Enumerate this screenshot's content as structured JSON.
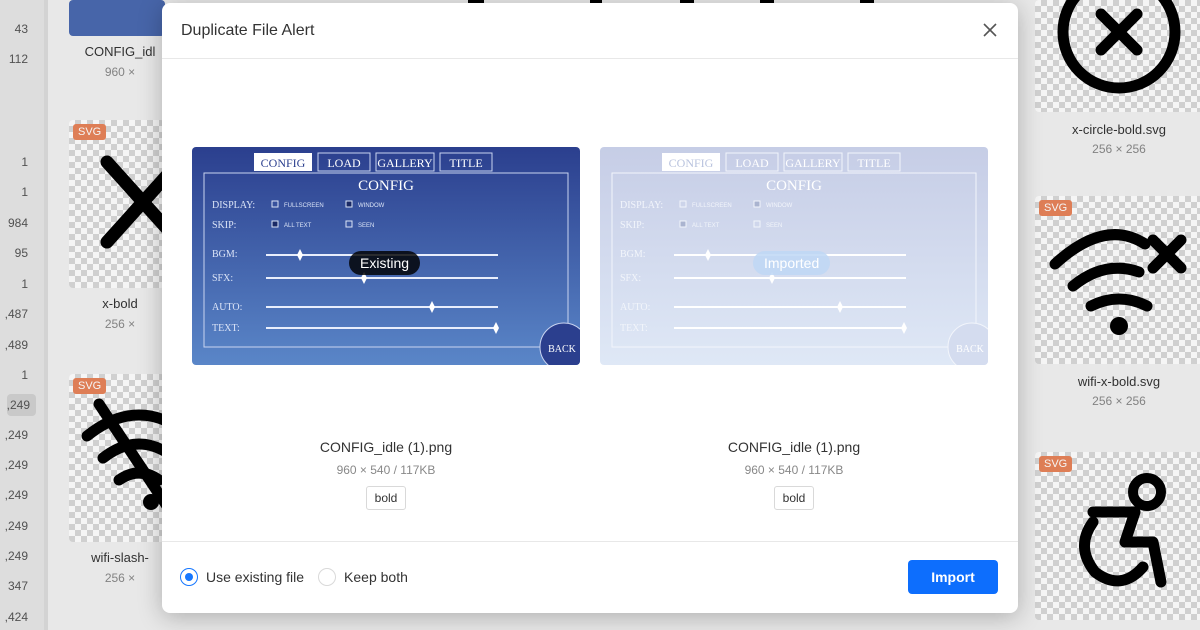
{
  "background": {
    "counts": [
      "43",
      "112",
      "1",
      "1",
      "984",
      "95",
      "1",
      ",487",
      ",489",
      "1",
      ",249",
      ",249",
      ",249",
      ",249",
      ",249",
      ",249",
      "347",
      ",424"
    ],
    "tiles": [
      {
        "name": "CONFIG_idl",
        "dim": "960 ×",
        "svg": false
      },
      {
        "name": "x-bold",
        "dim": "256 ×",
        "svg": true,
        "badge": "SVG"
      },
      {
        "name": "wifi-slash-",
        "dim": "256 ×",
        "svg": true,
        "badge": "SVG"
      },
      {
        "name": "x-circle-bold.svg",
        "dim": "256 × 256",
        "svg": false
      },
      {
        "name": "wifi-x-bold.svg",
        "dim": "256 × 256",
        "svg": true,
        "badge": "SVG"
      },
      {
        "name": "",
        "dim": "",
        "svg": true,
        "badge": "SVG"
      }
    ]
  },
  "modal": {
    "title": "Duplicate File Alert",
    "existing": {
      "chip": "Existing",
      "filename": "CONFIG_idle (1).png",
      "meta": "960 × 540 / 117KB",
      "tag": "bold"
    },
    "imported": {
      "chip": "Imported",
      "filename": "CONFIG_idle (1).png",
      "meta": "960 × 540 / 117KB",
      "tag": "bold"
    },
    "preview_text": {
      "tabs": [
        "CONFIG",
        "LOAD",
        "GALLERY",
        "TITLE"
      ],
      "heading": "CONFIG",
      "rows": [
        "DISPLAY:",
        "SKIP:",
        "BGM:",
        "SFX:",
        "AUTO:",
        "TEXT:"
      ],
      "opts": [
        "FULLSCREEN",
        "WINDOW",
        "ALL TEXT",
        "SEEN"
      ],
      "back": "BACK"
    },
    "options": [
      {
        "label": "Use existing file",
        "checked": true
      },
      {
        "label": "Keep both",
        "checked": false
      }
    ],
    "import_label": "Import",
    "accent": "#1677ff"
  }
}
